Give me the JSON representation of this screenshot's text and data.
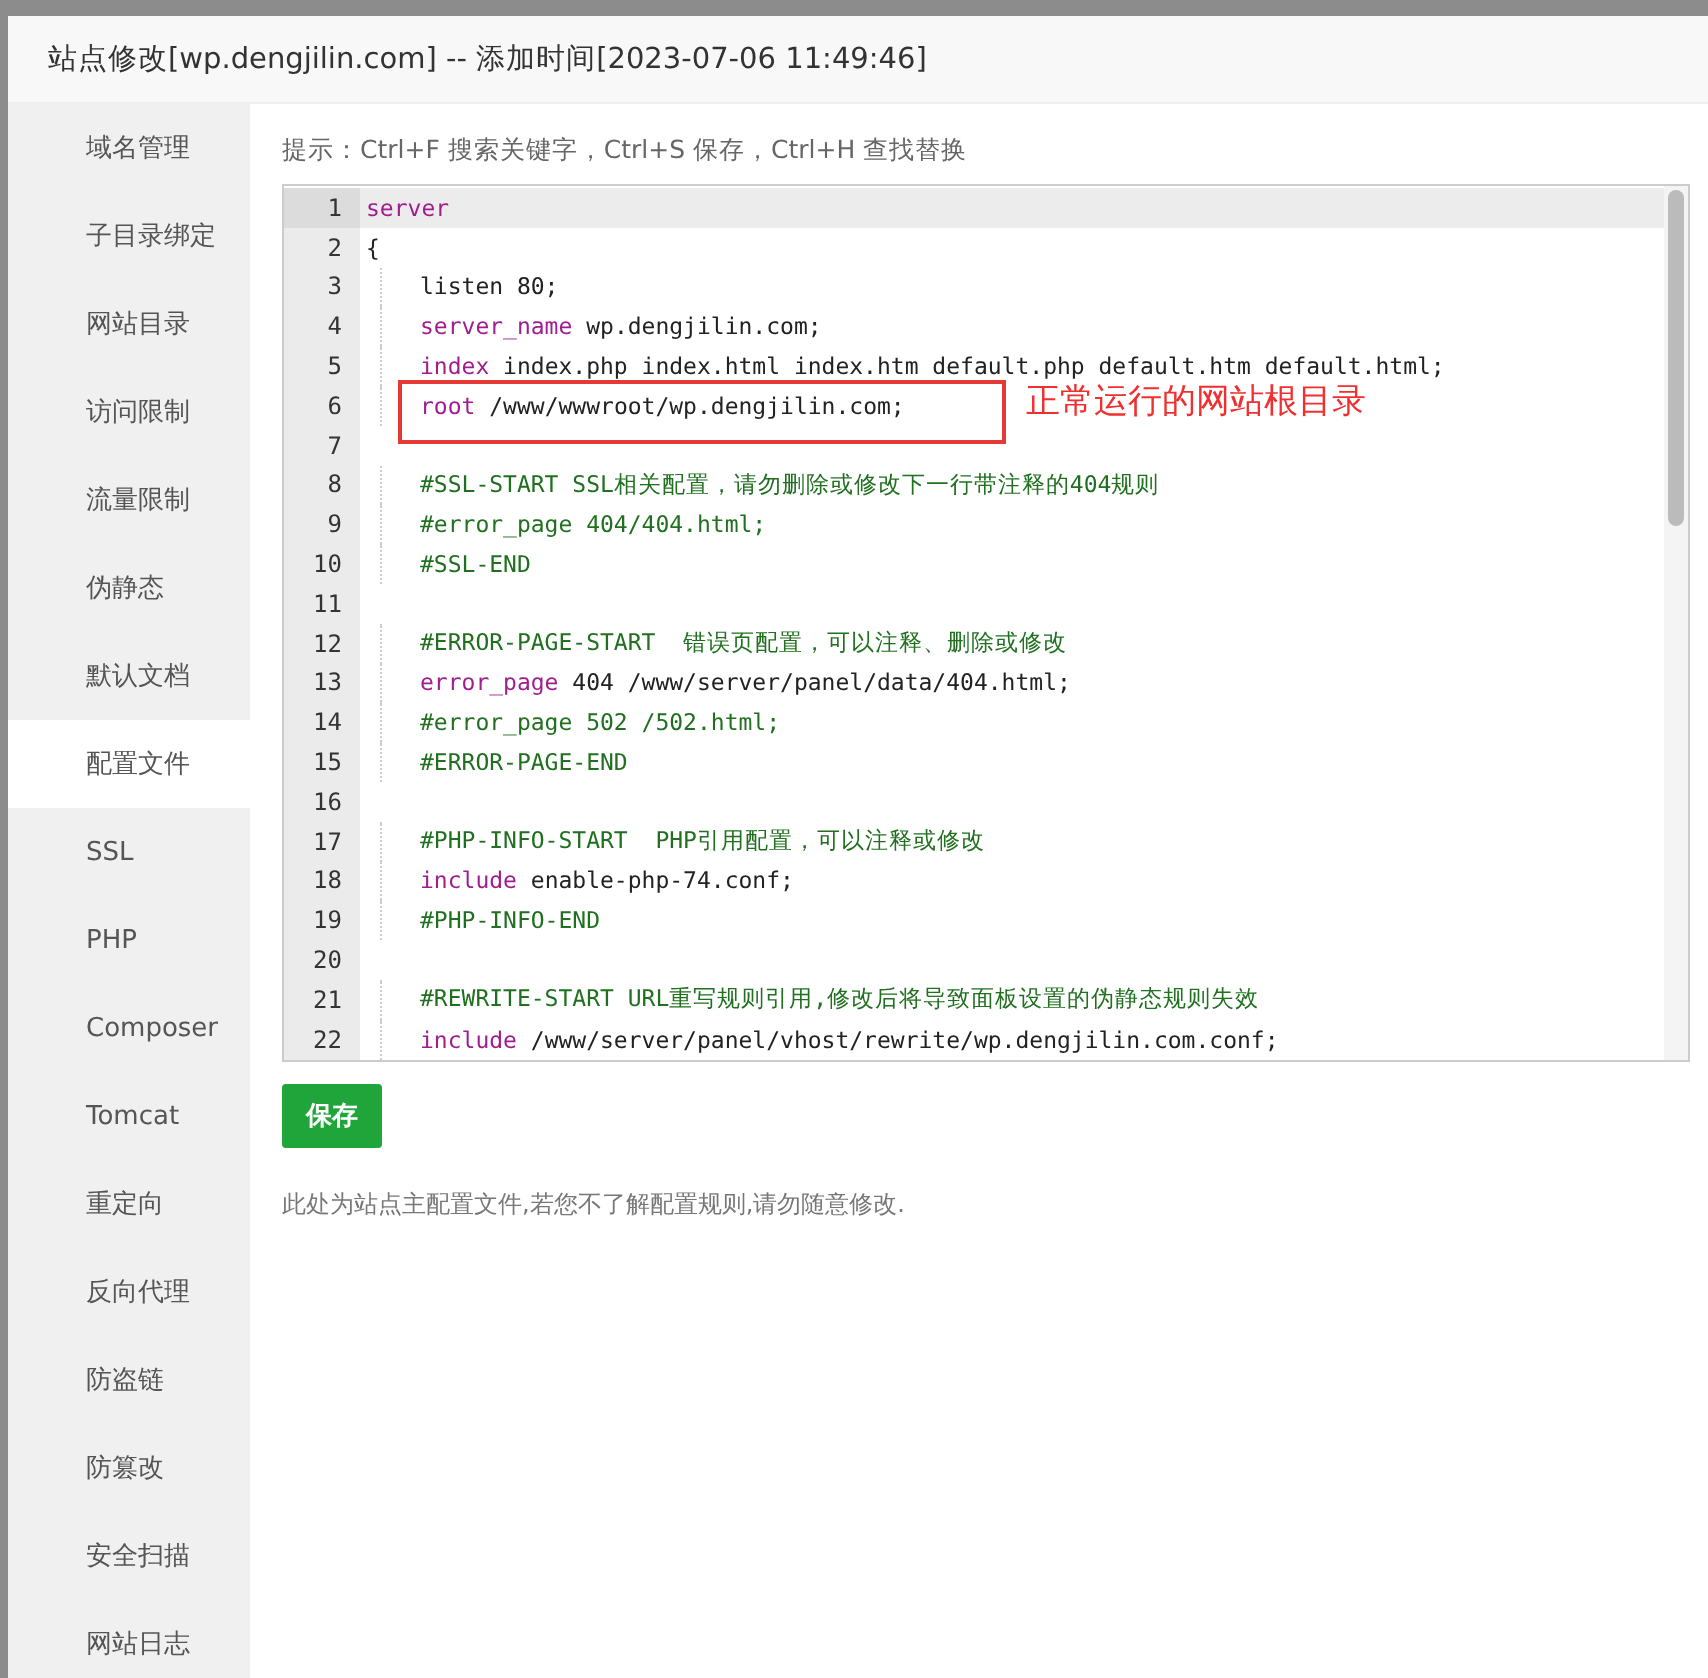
{
  "dialog": {
    "title": "站点修改[wp.dengjilin.com] -- 添加时间[2023-07-06 11:49:46]"
  },
  "sidebar": {
    "items": [
      {
        "label": "域名管理",
        "selected": false
      },
      {
        "label": "子目录绑定",
        "selected": false
      },
      {
        "label": "网站目录",
        "selected": false
      },
      {
        "label": "访问限制",
        "selected": false
      },
      {
        "label": "流量限制",
        "selected": false
      },
      {
        "label": "伪静态",
        "selected": false
      },
      {
        "label": "默认文档",
        "selected": false
      },
      {
        "label": "配置文件",
        "selected": true
      },
      {
        "label": "SSL",
        "selected": false
      },
      {
        "label": "PHP",
        "selected": false
      },
      {
        "label": "Composer",
        "selected": false
      },
      {
        "label": "Tomcat",
        "selected": false
      },
      {
        "label": "重定向",
        "selected": false
      },
      {
        "label": "反向代理",
        "selected": false
      },
      {
        "label": "防盗链",
        "selected": false
      },
      {
        "label": "防篡改",
        "selected": false
      },
      {
        "label": "安全扫描",
        "selected": false
      },
      {
        "label": "网站日志",
        "selected": false
      }
    ]
  },
  "hint": "提示：Ctrl+F 搜索关键字，Ctrl+S 保存，Ctrl+H 查找替换",
  "editor": {
    "lines": [
      {
        "number": "1",
        "active": true,
        "tokens": [
          {
            "kind": "keyword",
            "text": "server"
          }
        ]
      },
      {
        "number": "2",
        "active": false,
        "tokens": [
          {
            "kind": "plain",
            "text": "{"
          }
        ]
      },
      {
        "number": "3",
        "active": false,
        "indented": true,
        "tokens": [
          {
            "kind": "plain",
            "text": "listen 80;"
          }
        ]
      },
      {
        "number": "4",
        "active": false,
        "indented": true,
        "tokens": [
          {
            "kind": "keyword",
            "text": "server_name"
          },
          {
            "kind": "plain",
            "text": " wp.dengjilin.com;"
          }
        ]
      },
      {
        "number": "5",
        "active": false,
        "indented": true,
        "tokens": [
          {
            "kind": "keyword",
            "text": "index"
          },
          {
            "kind": "plain",
            "text": " index.php index.html index.htm default.php default.htm default.html;"
          }
        ]
      },
      {
        "number": "6",
        "active": false,
        "indented": true,
        "annotation": "正常运行的网站根目录",
        "tokens": [
          {
            "kind": "keyword",
            "text": "root"
          },
          {
            "kind": "plain",
            "text": " /www/wwwroot/wp.dengjilin.com;"
          }
        ]
      },
      {
        "number": "7",
        "active": false
      },
      {
        "number": "8",
        "active": false,
        "indented": true,
        "tokens": [
          {
            "kind": "comment",
            "text": "#SSL-START SSL相关配置，请勿删除或修改下一行带注释的404规则"
          }
        ]
      },
      {
        "number": "9",
        "active": false,
        "indented": true,
        "tokens": [
          {
            "kind": "comment",
            "text": "#error_page 404/404.html;"
          }
        ]
      },
      {
        "number": "10",
        "active": false,
        "indented": true,
        "tokens": [
          {
            "kind": "comment",
            "text": "#SSL-END"
          }
        ]
      },
      {
        "number": "11",
        "active": false
      },
      {
        "number": "12",
        "active": false,
        "indented": true,
        "tokens": [
          {
            "kind": "comment",
            "text": "#ERROR-PAGE-START  错误页配置，可以注释、删除或修改"
          }
        ]
      },
      {
        "number": "13",
        "active": false,
        "indented": true,
        "tokens": [
          {
            "kind": "keyword",
            "text": "error_page"
          },
          {
            "kind": "plain",
            "text": " 404 /www/server/panel/data/404.html;"
          }
        ]
      },
      {
        "number": "14",
        "active": false,
        "indented": true,
        "tokens": [
          {
            "kind": "comment",
            "text": "#error_page 502 /502.html;"
          }
        ]
      },
      {
        "number": "15",
        "active": false,
        "indented": true,
        "tokens": [
          {
            "kind": "comment",
            "text": "#ERROR-PAGE-END"
          }
        ]
      },
      {
        "number": "16",
        "active": false
      },
      {
        "number": "17",
        "active": false,
        "indented": true,
        "tokens": [
          {
            "kind": "comment",
            "text": "#PHP-INFO-START  PHP引用配置，可以注释或修改"
          }
        ]
      },
      {
        "number": "18",
        "active": false,
        "indented": true,
        "tokens": [
          {
            "kind": "keyword",
            "text": "include"
          },
          {
            "kind": "plain",
            "text": " enable-php-74.conf;"
          }
        ]
      },
      {
        "number": "19",
        "active": false,
        "indented": true,
        "tokens": [
          {
            "kind": "comment",
            "text": "#PHP-INFO-END"
          }
        ]
      },
      {
        "number": "20",
        "active": false
      },
      {
        "number": "21",
        "active": false,
        "indented": true,
        "tokens": [
          {
            "kind": "comment",
            "text": "#REWRITE-START URL重写规则引用,修改后将导致面板设置的伪静态规则失效"
          }
        ]
      },
      {
        "number": "22",
        "active": false,
        "indented": true,
        "tokens": [
          {
            "kind": "keyword",
            "text": "include"
          },
          {
            "kind": "plain",
            "text": " /www/server/panel/vhost/rewrite/wp.dengjilin.com.conf;"
          }
        ]
      }
    ]
  },
  "save_button": "保存",
  "note": "此处为站点主配置文件,若您不了解配置规则,请勿随意修改."
}
